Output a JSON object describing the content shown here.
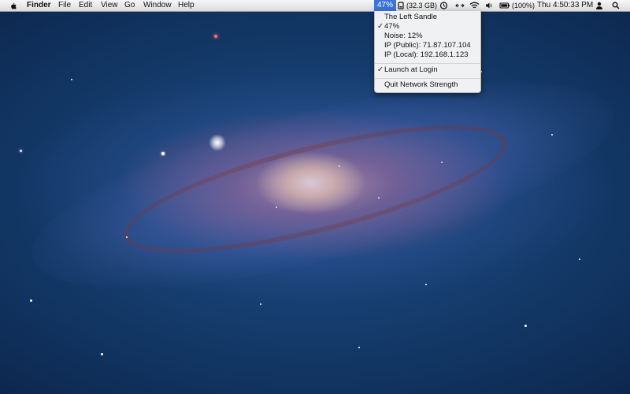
{
  "menubar": {
    "app_name": "Finder",
    "menus": [
      "File",
      "Edit",
      "View",
      "Go",
      "Window",
      "Help"
    ],
    "network_percent": "47%",
    "storage": "(32.3 GB)",
    "battery": "(100%)",
    "clock": "Thu 4:50:33 PM"
  },
  "dropdown": {
    "network_name": "The Left Sandle",
    "signal": "47%",
    "noise": "Noise: 12%",
    "ip_public": "IP (Public): 71.87.107.104",
    "ip_local": "IP (Local): 192.168.1.123",
    "launch_at_login": "Launch at Login",
    "quit": "Quit Network Strength",
    "check_mark": "✓"
  },
  "icons": {
    "apple": "apple-icon",
    "disk": "disk-icon",
    "time_machine": "time-machine-icon",
    "network_arrows": "network-arrows-icon",
    "wifi": "wifi-icon",
    "volume": "volume-icon",
    "battery": "battery-icon",
    "user": "user-icon",
    "spotlight": "spotlight-icon"
  },
  "colors": {
    "highlight": "#3c74d9",
    "menubar": "#e8e8e8"
  }
}
